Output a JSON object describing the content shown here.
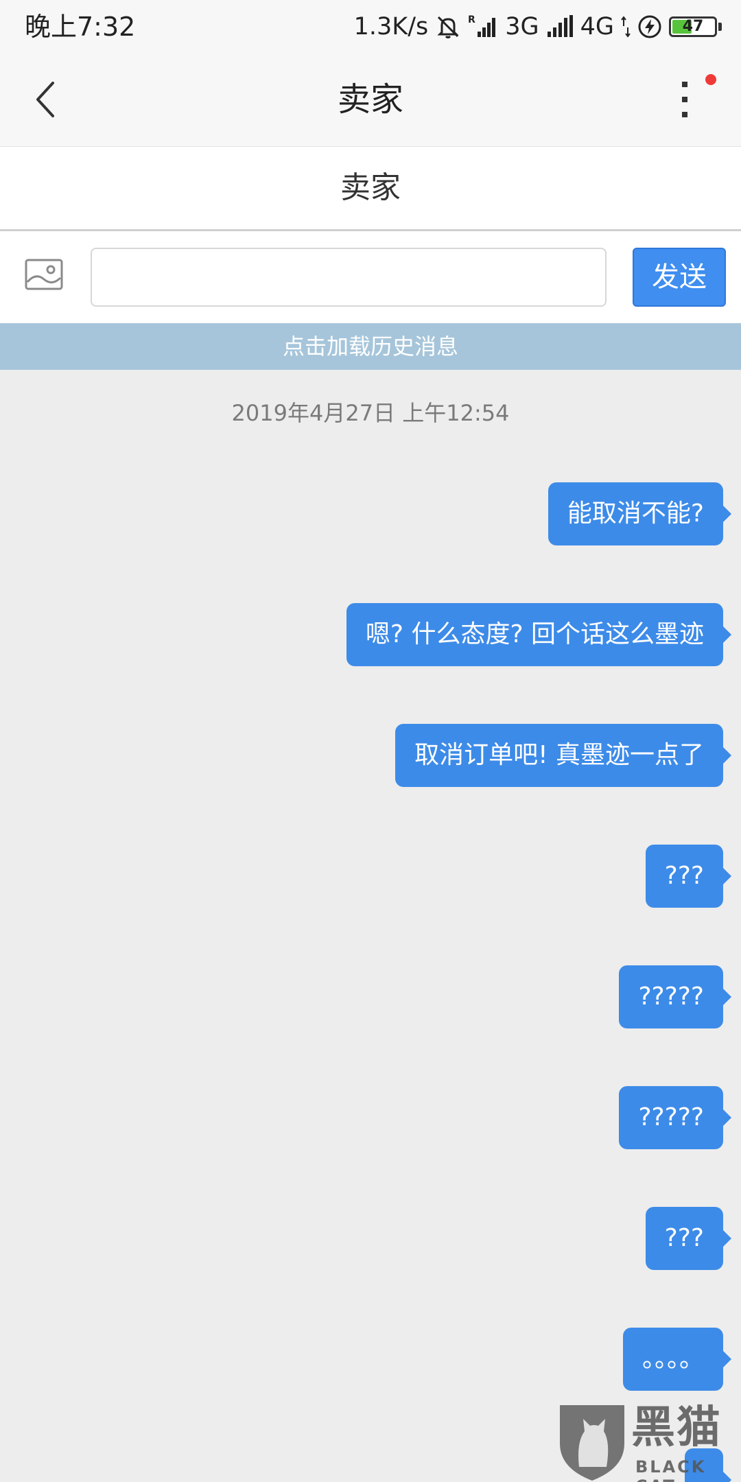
{
  "status_bar": {
    "time": "晚上7:32",
    "net_speed": "1.3K/s",
    "network_1": "3G",
    "network_2": "4G",
    "battery": "47",
    "battery_level": 0.47
  },
  "header": {
    "title": "卖家"
  },
  "sub_header": {
    "name": "卖家"
  },
  "input_bar": {
    "placeholder": "",
    "value": "",
    "send_label": "发送"
  },
  "history": {
    "load_label": "点击加载历史消息"
  },
  "chat": {
    "timestamp": "2019年4月27日 上午12:54",
    "messages": [
      {
        "text": "能取消不能?"
      },
      {
        "text": "嗯? 什么态度? 回个话这么墨迹"
      },
      {
        "text": "取消订单吧! 真墨迹一点了"
      },
      {
        "text": "???"
      },
      {
        "text": "?????"
      },
      {
        "text": "?????"
      },
      {
        "text": "???"
      },
      {
        "text": "。。。。"
      }
    ]
  },
  "watermark": {
    "brand": "黑猫",
    "sub": "BLACK CAT"
  },
  "colors": {
    "accent": "#3d8be8",
    "history_bar": "#a6c5da",
    "notification": "#f03a3a",
    "background": "#ededed"
  }
}
